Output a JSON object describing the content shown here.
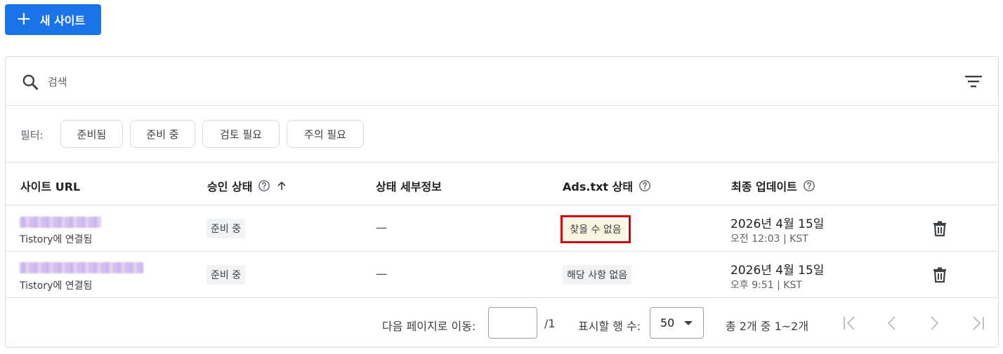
{
  "toolbar": {
    "new_site_label": "새 사이트",
    "new_site_icon": "plus-icon"
  },
  "search": {
    "placeholder": "검색",
    "value": ""
  },
  "filters": {
    "label": "필터:",
    "chips": [
      "준비됨",
      "준비 중",
      "검토 필요",
      "주의 필요"
    ]
  },
  "table": {
    "columns": {
      "site_url": "사이트 URL",
      "approval_status": "승인 상태",
      "status_details": "상태 세부정보",
      "ads_txt_status": "Ads.txt 상태",
      "last_updated": "최종 업데이트"
    },
    "rows": [
      {
        "connected": "Tistory에 연결됨",
        "approval": "준비 중",
        "details": "—",
        "ads_txt": "찾을 수 없음",
        "date": "2026년 4월 15일",
        "time": "오전 12:03 | KST"
      },
      {
        "connected": "Tistory에 연결됨",
        "approval": "준비 중",
        "details": "—",
        "ads_txt": "해당 사항 없음",
        "date": "2026년 4월 15일",
        "time": "오후 9:51 | KST"
      }
    ]
  },
  "pagination": {
    "goto_label": "다음 페이지로 이동:",
    "goto_value": "",
    "total_pages": "/1",
    "rows_label": "표시할 행 수:",
    "rows_value": "50",
    "summary": "총 2개 중 1~2개"
  },
  "colors": {
    "primary": "#1a73e8",
    "highlight_border": "#d50000",
    "ads_badge_bg": "#fbf6e0"
  }
}
